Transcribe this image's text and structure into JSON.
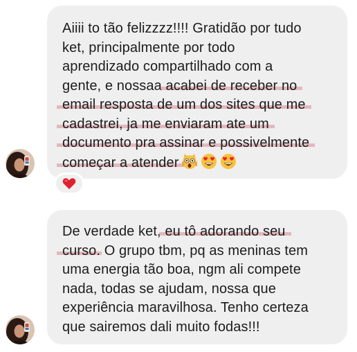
{
  "messages": [
    {
      "lines": [
        {
          "text": "Aiiii to tão felizzzz!!!! Gratidão por tudo"
        },
        {
          "text": "ket, principalmente por todo"
        },
        {
          "text": "aprendizado compartilhado com a"
        },
        {
          "pre": "gente, e nossaa ",
          "hl": "acabei de receber no"
        },
        {
          "hl": "email resposta de um dos sites que me"
        },
        {
          "hl": "cadastrei, ja me enviaram ate um"
        },
        {
          "hl": "documento pra assinar e possivelmente"
        },
        {
          "hl": "começar a atender"
        }
      ],
      "emojis": [
        "scared-cat-emoji",
        "heart-eyes-emoji",
        "heart-eyes-emoji"
      ],
      "reaction": "red-heart-emoji"
    },
    {
      "lines": [
        {
          "pre": "De verdade ket, ",
          "hl": "eu tô adorando seu"
        },
        {
          "hl": "curso",
          "post": ". O grupo tbm, pq as meninas tem"
        },
        {
          "text": "uma energia tão boa, ngm ali compete"
        },
        {
          "text": "nada, todas se ajudam, nossa que"
        },
        {
          "text": "experiência maravilhosa. Tenho certeza"
        },
        {
          "text": "que sairemos dali muito fodas!!!"
        }
      ]
    }
  ],
  "colors": {
    "bubble": "#efefef",
    "text": "#1c1c1c",
    "highlight": "#d68c96",
    "reaction_heart": "#e0202e"
  }
}
